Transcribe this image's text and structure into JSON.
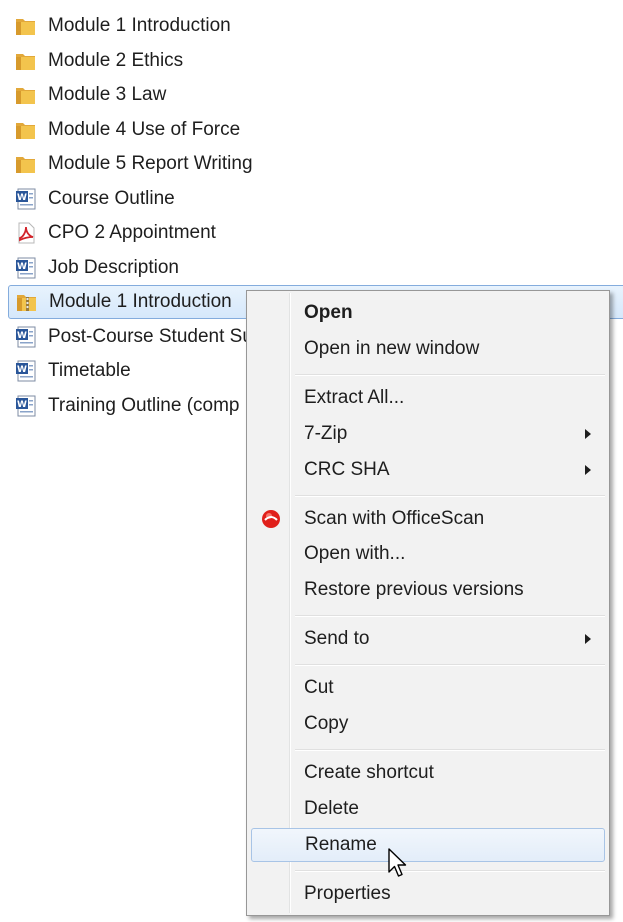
{
  "files": [
    {
      "label": "Module 1 Introduction",
      "icon": "folder-icon"
    },
    {
      "label": "Module 2 Ethics",
      "icon": "folder-icon"
    },
    {
      "label": "Module 3 Law",
      "icon": "folder-icon"
    },
    {
      "label": "Module 4 Use of Force",
      "icon": "folder-icon"
    },
    {
      "label": "Module 5 Report Writing",
      "icon": "folder-icon"
    },
    {
      "label": "Course Outline",
      "icon": "word-document-icon"
    },
    {
      "label": "CPO 2 Appointment",
      "icon": "pdf-icon"
    },
    {
      "label": "Job Description",
      "icon": "word-document-icon"
    },
    {
      "label": "Module 1 Introduction",
      "icon": "zip-folder-icon"
    },
    {
      "label": "Post-Course Student Su",
      "icon": "word-document-icon"
    },
    {
      "label": "Timetable",
      "icon": "word-document-icon"
    },
    {
      "label": "Training Outline (comp",
      "icon": "word-document-icon"
    }
  ],
  "menu": {
    "open": "Open",
    "open_new_window": "Open in new window",
    "extract_all": "Extract All...",
    "seven_zip": "7-Zip",
    "crc_sha": "CRC SHA",
    "scan_officescan": "Scan with OfficeScan",
    "open_with": "Open with...",
    "restore_versions": "Restore previous versions",
    "send_to": "Send to",
    "cut": "Cut",
    "copy": "Copy",
    "create_shortcut": "Create shortcut",
    "delete": "Delete",
    "rename": "Rename",
    "properties": "Properties"
  },
  "colors": {
    "selection_border": "#84acdd",
    "menu_background": "#f2f2f2",
    "folder_yellow": "#f3c44d",
    "word_blue": "#2a5699",
    "pdf_red": "#d2232a",
    "officescan_red": "#e0201b"
  }
}
